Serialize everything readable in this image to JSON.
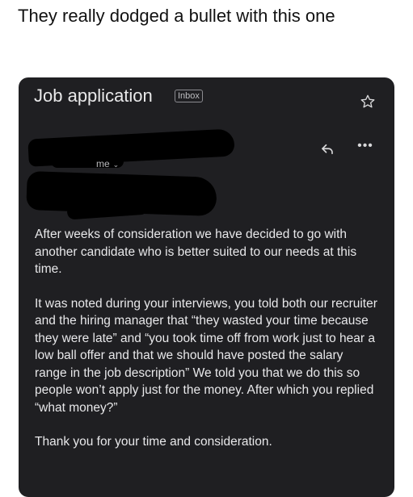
{
  "post": {
    "caption": "They really dodged a bullet with this one"
  },
  "email": {
    "subject": "Job application",
    "label_badge": "Inbox",
    "recipient_label": "me",
    "recipient_chevron": "⌄",
    "more_glyph": "•••",
    "paragraphs": [
      "After weeks of consideration we have decided to go with another candidate who is better suited to our needs at this time.",
      "It was noted during your interviews, you told both our recruiter and the hiring manager that “they wasted your time because they were late” and “you took time off from work just to hear a low ball offer and that we should have posted the salary range in the job description” We told you that we do this so people won’t apply just for the money. After which you replied “what money?”",
      "Thank you for your time and consideration."
    ]
  },
  "icons": {
    "star": "star-icon",
    "reply": "reply-icon",
    "more": "more-options-icon"
  },
  "colors": {
    "page_background": "#ffffff",
    "email_background": "#1f1f22",
    "email_text": "#e8e8ea",
    "redaction": "#000000"
  }
}
